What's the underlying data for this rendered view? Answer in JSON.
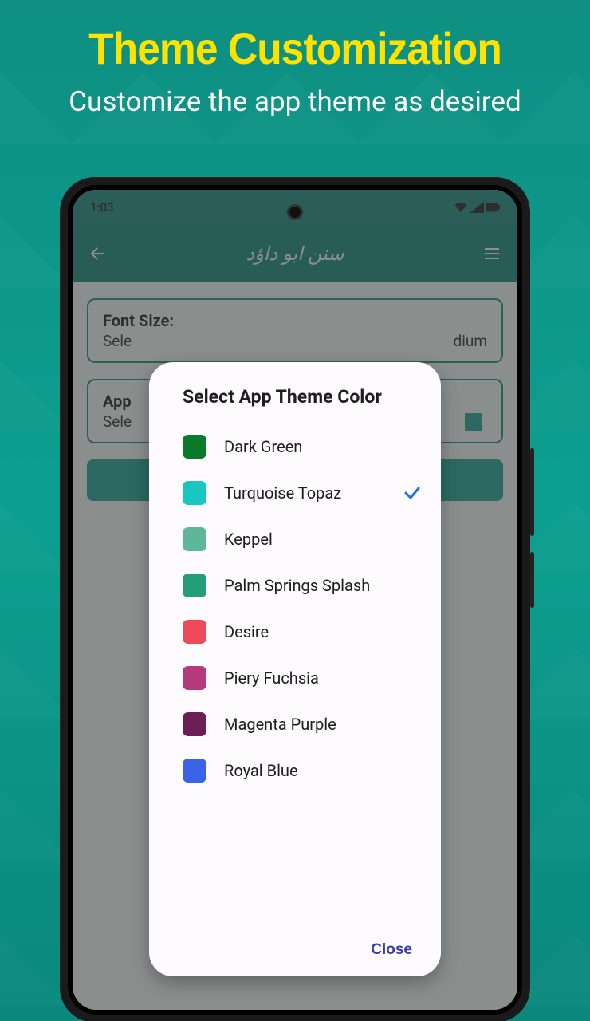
{
  "promo": {
    "title": "Theme Customization",
    "subtitle": "Customize the app theme as desired"
  },
  "statusbar": {
    "time": "1:03"
  },
  "appbar": {
    "title": "سنن ابو داؤد"
  },
  "cards": {
    "font": {
      "title": "Font Size:",
      "subtitle_left": "Sele",
      "subtitle_right": "dium"
    },
    "theme": {
      "title": "App",
      "subtitle_left": "Sele"
    }
  },
  "dialog": {
    "title": "Select App Theme Color",
    "options": [
      {
        "label": "Dark Green",
        "color": "#0b7a2a",
        "selected": false
      },
      {
        "label": "Turquoise Topaz",
        "color": "#18c7c0",
        "selected": true
      },
      {
        "label": "Keppel",
        "color": "#5fb79a",
        "selected": false
      },
      {
        "label": "Palm Springs Splash",
        "color": "#239e77",
        "selected": false
      },
      {
        "label": "Desire",
        "color": "#ef4a59",
        "selected": false
      },
      {
        "label": "Piery Fuchsia",
        "color": "#b6397b",
        "selected": false
      },
      {
        "label": "Magenta Purple",
        "color": "#6b1f55",
        "selected": false
      },
      {
        "label": "Royal Blue",
        "color": "#3a63e8",
        "selected": false
      }
    ],
    "close_label": "Close"
  }
}
